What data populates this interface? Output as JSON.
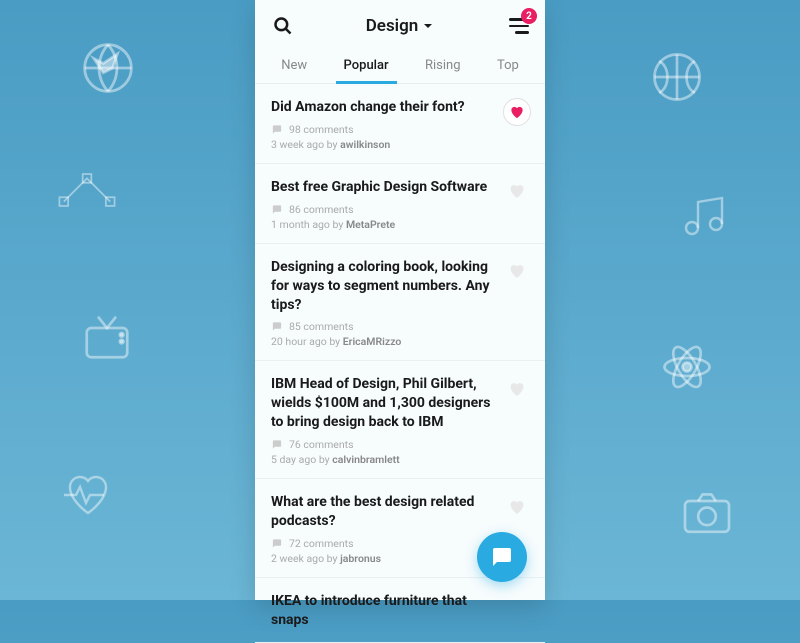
{
  "header": {
    "title": "Design",
    "badge_count": "2"
  },
  "tabs": [
    {
      "label": "New",
      "active": false
    },
    {
      "label": "Popular",
      "active": true
    },
    {
      "label": "Rising",
      "active": false
    },
    {
      "label": "Top",
      "active": false
    }
  ],
  "posts": [
    {
      "title": "Did Amazon change their font?",
      "comments": "98 comments",
      "time": "3 week ago by ",
      "author": "awilkinson",
      "liked": true
    },
    {
      "title": "Best free Graphic Design Software",
      "comments": "86 comments",
      "time": "1 month ago by ",
      "author": "MetaPrete",
      "liked": false
    },
    {
      "title": "Designing a coloring book, looking for ways to segment numbers. Any tips?",
      "comments": "85 comments",
      "time": "20 hour ago by ",
      "author": "EricaMRizzo",
      "liked": false
    },
    {
      "title": "IBM Head of Design, Phil Gilbert, wields $100M and 1,300 designers to bring design back to IBM",
      "comments": "76 comments",
      "time": "5 day ago by ",
      "author": "calvinbramlett",
      "liked": false
    },
    {
      "title": "What are the best design related podcasts?",
      "comments": "72 comments",
      "time": "2 week ago by ",
      "author": "jabronus",
      "liked": false
    },
    {
      "title": "IKEA to introduce furniture that snaps",
      "comments": "",
      "time": "",
      "author": "",
      "liked": false
    }
  ]
}
